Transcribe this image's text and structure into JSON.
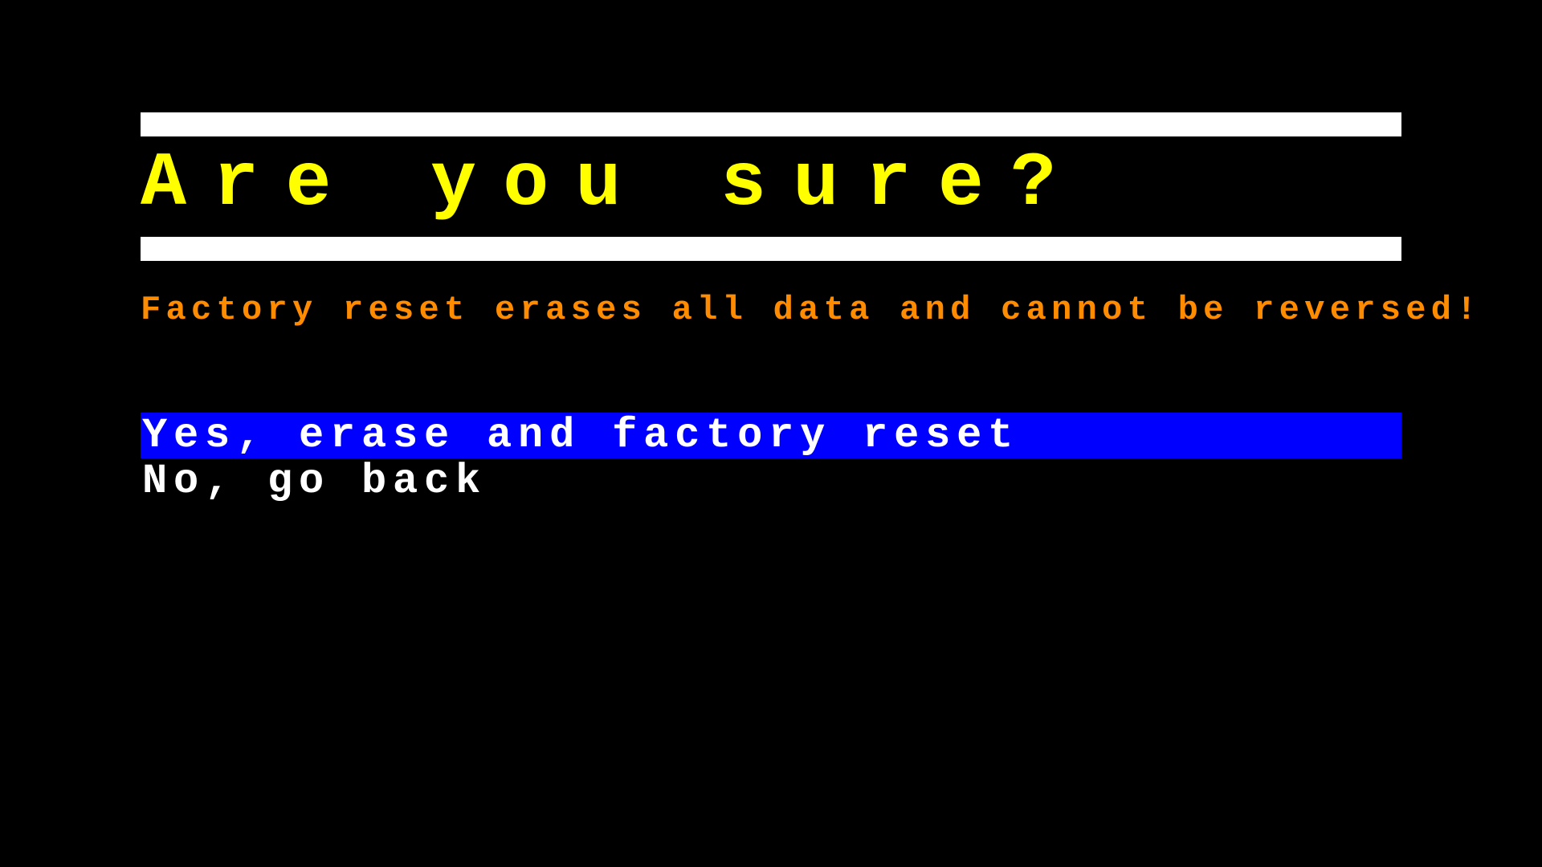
{
  "title": "Are you sure?",
  "warning": "Factory reset erases all data and cannot be reversed!",
  "menu": {
    "items": [
      {
        "label": "Yes, erase and factory reset",
        "selected": true
      },
      {
        "label": "No, go back",
        "selected": false
      }
    ]
  },
  "colors": {
    "background": "#000000",
    "title": "#ffff00",
    "warning": "#ff8c00",
    "selection": "#0000ff",
    "text": "#ffffff",
    "rule": "#ffffff"
  }
}
